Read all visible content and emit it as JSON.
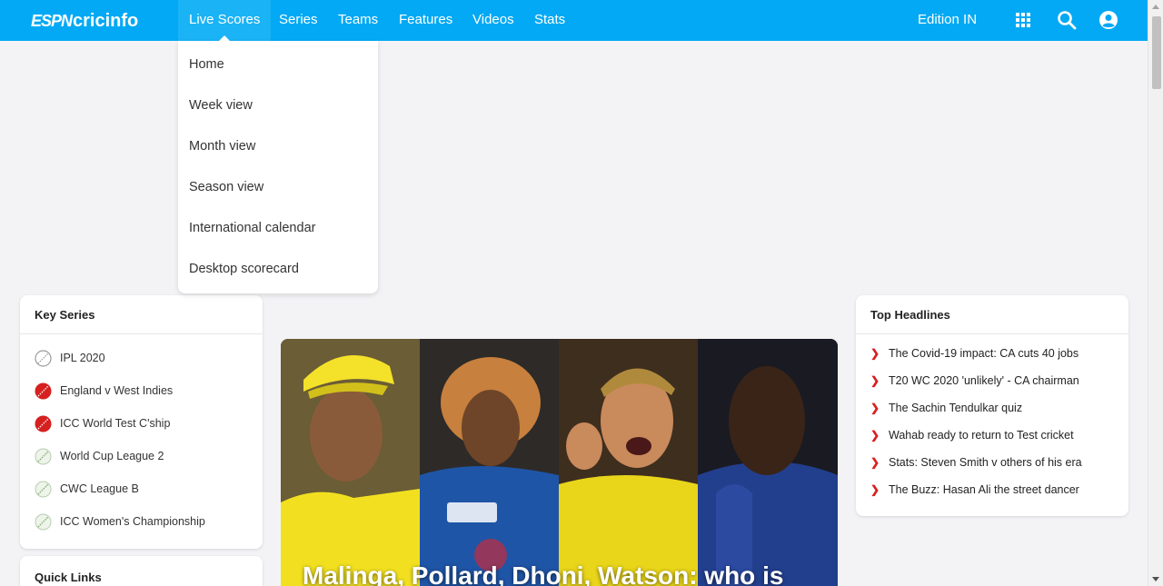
{
  "brand": {
    "logo_text": "ESPN cricinfo"
  },
  "nav": {
    "items": [
      "Live Scores",
      "Series",
      "Teams",
      "Features",
      "Videos",
      "Stats"
    ],
    "edition": "Edition IN",
    "icons": [
      "apps-grid-icon",
      "search-icon",
      "user-account-icon"
    ]
  },
  "dropdown": {
    "items": [
      "Home",
      "Week view",
      "Month view",
      "Season view",
      "International calendar",
      "Desktop scorecard"
    ]
  },
  "key_series": {
    "title": "Key Series",
    "items": [
      {
        "label": "IPL 2020",
        "icon": "ball-outline-icon"
      },
      {
        "label": "England v West Indies",
        "icon": "red-ball-icon"
      },
      {
        "label": "ICC World Test C'ship",
        "icon": "red-ball-icon"
      },
      {
        "label": "World Cup League 2",
        "icon": "white-ball-icon"
      },
      {
        "label": "CWC League B",
        "icon": "white-ball-icon"
      },
      {
        "label": "ICC Women's Championship",
        "icon": "white-ball-icon"
      }
    ]
  },
  "quick_links": {
    "title": "Quick Links"
  },
  "top_headlines": {
    "title": "Top Headlines",
    "items": [
      "The Covid-19 impact: CA cuts 40 jobs",
      "T20 WC 2020 'unlikely' - CA chairman",
      "The Sachin Tendulkar quiz",
      "Wahab ready to return to Test cricket",
      "Stats: Steven Smith v others of his era",
      "The Buzz: Hasan Ali the street dancer"
    ]
  },
  "feature": {
    "caption": "Malinga, Pollard, Dhoni, Watson: who is",
    "panels": [
      "Dhoni",
      "Malinga",
      "Watson",
      "Pollard"
    ]
  },
  "colors": {
    "nav_bg": "#03a9f4",
    "page_bg": "#f3f3f6",
    "accent_red": "#d62020"
  }
}
